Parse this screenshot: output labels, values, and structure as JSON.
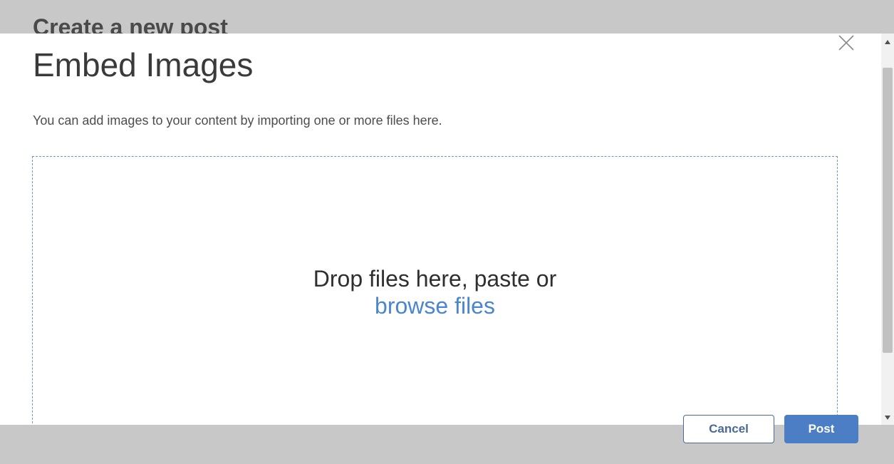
{
  "background_page": {
    "title": "Create a new post",
    "cancel_label": "Cancel",
    "post_label": "Post"
  },
  "modal": {
    "title": "Embed Images",
    "description": "You can add images to your content by importing one or more files here.",
    "dropzone": {
      "prompt": "Drop files here, paste or",
      "browse_link": "browse files"
    },
    "close_icon": "close-icon"
  },
  "colors": {
    "overlay": "#c8c8c8",
    "link": "#4a86cf",
    "dropzone_border": "#6e93c8",
    "post_button": "#4b7ec4",
    "cancel_border": "#4a6a94"
  }
}
